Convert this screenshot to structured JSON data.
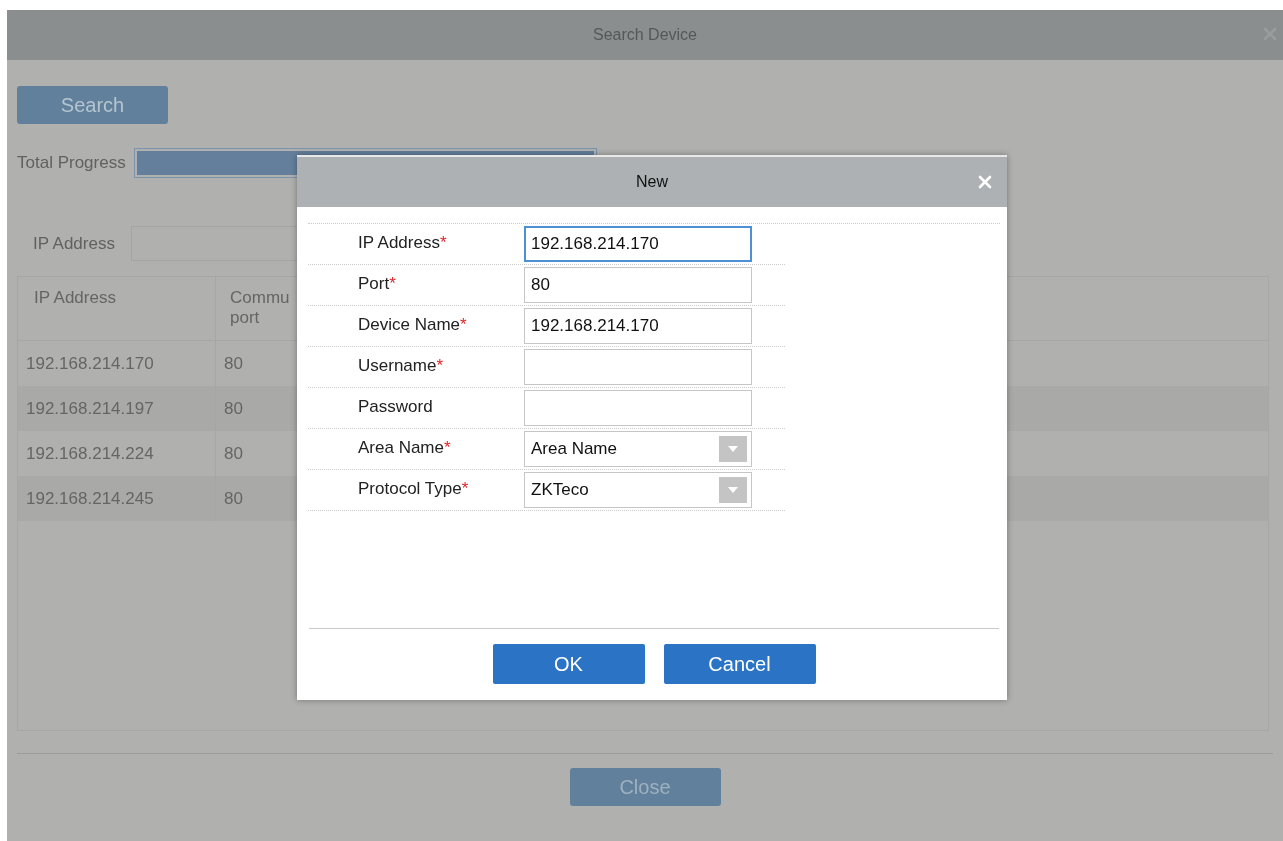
{
  "window": {
    "title": "Search Device"
  },
  "search_button": "Search",
  "progress": {
    "label": "Total Progress",
    "level": 1
  },
  "filter": {
    "label": "IP Address"
  },
  "table": {
    "columns": [
      "IP Address",
      "Commu port"
    ],
    "rows": [
      [
        "192.168.214.170",
        "80"
      ],
      [
        "192.168.214.197",
        "80"
      ],
      [
        "192.168.214.224",
        "80"
      ],
      [
        "192.168.214.245",
        "80"
      ]
    ]
  },
  "close_button": "Close",
  "dialog": {
    "title": "New",
    "fields": [
      {
        "label": "IP Address",
        "required_mark": "*",
        "kind": "text",
        "value": "192.168.214.170",
        "focused": true
      },
      {
        "label": "Port",
        "required_mark": "*",
        "kind": "text",
        "value": "80",
        "focused": false
      },
      {
        "label": "Device Name",
        "required_mark": "*",
        "kind": "text",
        "value": "192.168.214.170",
        "focused": false
      },
      {
        "label": "Username",
        "required_mark": "*",
        "kind": "text",
        "focused": false
      },
      {
        "label": "Password",
        "kind": "text",
        "focused": false
      },
      {
        "label": "Area Name",
        "required_mark": "*",
        "kind": "select",
        "value": "Area Name",
        "focused": false
      },
      {
        "label": "Protocol Type",
        "required_mark": "*",
        "kind": "select",
        "value": "ZKTeco",
        "focused": false
      }
    ],
    "buttons": [
      "OK",
      "Cancel"
    ]
  }
}
